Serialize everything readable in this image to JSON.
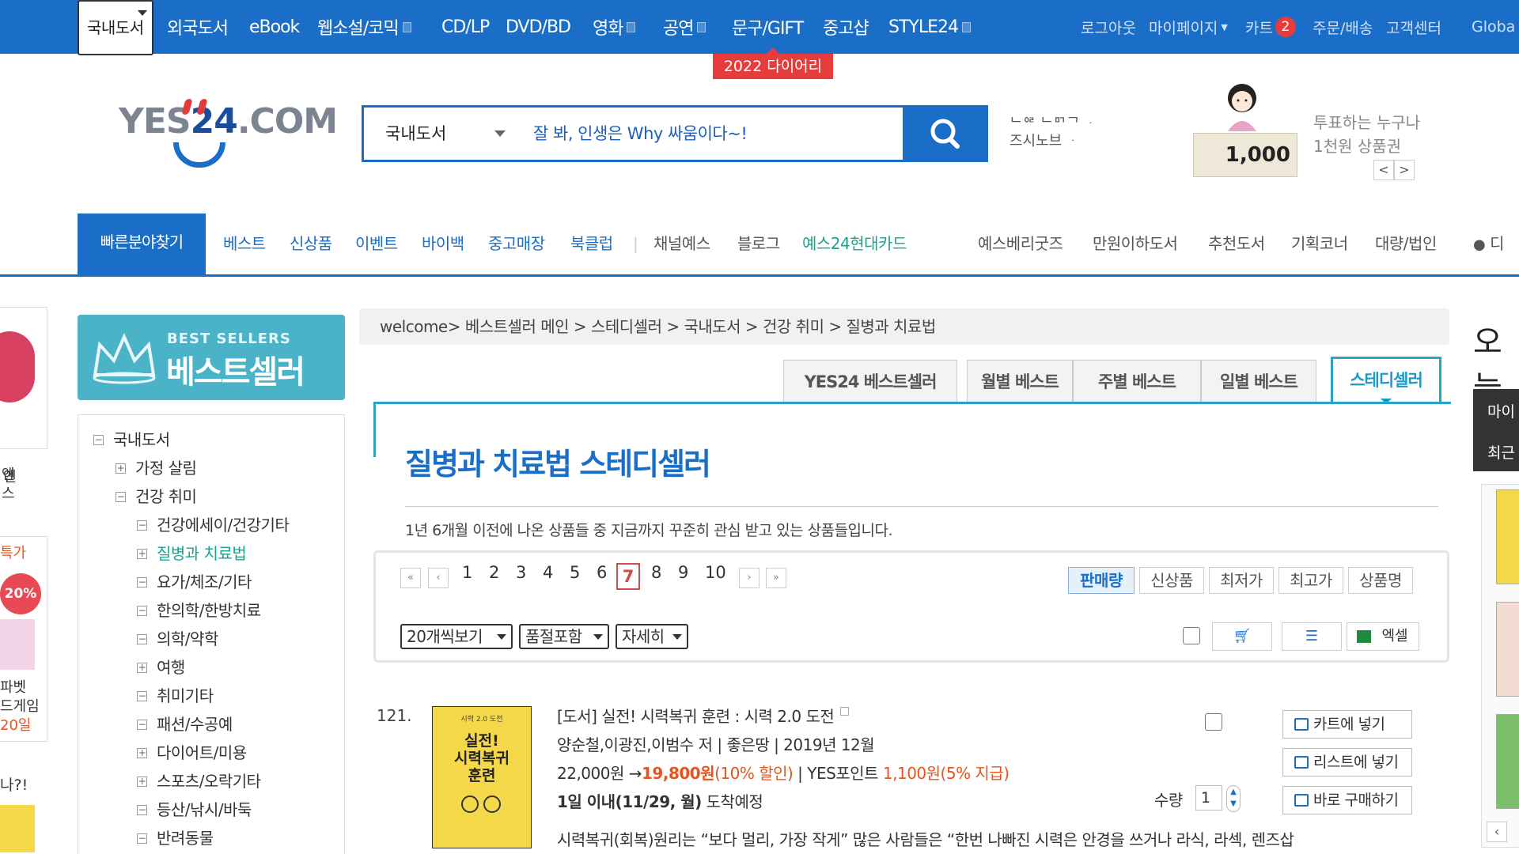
{
  "topnav": {
    "items": [
      {
        "label": "국내도서",
        "selected": true
      },
      {
        "label": "외국도서"
      },
      {
        "label": "eBook"
      },
      {
        "label": "웹소설/코믹",
        "box": true
      },
      {
        "label": "CD/LP"
      },
      {
        "label": "DVD/BD"
      },
      {
        "label": "영화",
        "box": true
      },
      {
        "label": "공연",
        "box": true
      },
      {
        "label": "문구/GIFT"
      },
      {
        "label": "중고샵"
      },
      {
        "label": "STYLE24",
        "box": true
      }
    ],
    "util": {
      "logout": "로그아웃",
      "mypage": "마이페이지",
      "cart": "카트",
      "cart_count": "2",
      "order": "주문/배송",
      "cs": "고객센터",
      "global": "Globa"
    },
    "promo": "2022 다이어리"
  },
  "header": {
    "logo_a": "YES",
    "logo_b": "24",
    "logo_c": ".COM",
    "search": {
      "category": "국내도서",
      "query": "잘 봐, 인생은 Why 싸움이다~!"
    },
    "recent_line1": "ᄂᄋᄅ ᄂᄆᄀᄀ ᆞ",
    "recent_line2": "즈시노브 ᆞ",
    "ad": {
      "amount": "1,000",
      "title1": "투표하는 누구나",
      "title2": "1천원 상품권",
      "prev": "<",
      "next": ">"
    }
  },
  "nav2": {
    "quick": "빠른분야찾기",
    "items": [
      "베스트",
      "신상품",
      "이벤트",
      "바이백",
      "중고매장",
      "북클럽",
      "채널예스",
      "블로그",
      "예스24현대카드",
      "예스베리굿즈",
      "만원이하도서",
      "추천도서",
      "기획코너",
      "대량/법인",
      "디"
    ]
  },
  "sidebar": {
    "banner_small": "BEST SELLERS",
    "banner_big": "베스트셀러",
    "tree": [
      {
        "label": "국내도서",
        "pm": "−"
      },
      {
        "label": "가정 살림",
        "pm": "+"
      },
      {
        "label": "건강 취미",
        "pm": "−"
      },
      {
        "label": "건강에세이/건강기타",
        "pm": "−"
      },
      {
        "label": "질병과 치료법",
        "pm": "+",
        "on": true
      },
      {
        "label": "요가/체조/기타",
        "pm": "−"
      },
      {
        "label": "한의학/한방치료",
        "pm": "−"
      },
      {
        "label": "의학/약학",
        "pm": "−"
      },
      {
        "label": "여행",
        "pm": "+"
      },
      {
        "label": "취미기타",
        "pm": "−"
      },
      {
        "label": "패션/수공예",
        "pm": "−"
      },
      {
        "label": "다이어트/미용",
        "pm": "+"
      },
      {
        "label": "스포츠/오락기타",
        "pm": "+"
      },
      {
        "label": "등산/낚시/바둑",
        "pm": "−"
      },
      {
        "label": "반려동물",
        "pm": "−"
      }
    ],
    "left_fragments": {
      "a": "엔",
      "b": "스",
      "c": "특가",
      "d": "20%",
      "e": "파벳",
      "f": "드게임",
      "g": "20일",
      "h": "나?!"
    }
  },
  "main": {
    "breadcrumb": "welcome> 베스트셀러 메인 > 스테디셀러 > 국내도서 > 건강 취미 > 질병과 치료법",
    "tabs": [
      "YES24 베스트셀러",
      "월별 베스트",
      "주별 베스트",
      "일별 베스트",
      "스테디셀러"
    ],
    "title": "질병과 치료법 스테디셀러",
    "description": "1년 6개월 이전에 나온 상품들 중 지금까지 꾸준히 관심 받고 있는 상품들입니다.",
    "pages": [
      "1",
      "2",
      "3",
      "4",
      "5",
      "6",
      "7",
      "8",
      "9",
      "10"
    ],
    "current_page": "7",
    "sort": [
      "판매량",
      "신상품",
      "최저가",
      "최고가",
      "상품명"
    ],
    "selects": [
      "20개씩보기",
      "품절포함",
      "자세히"
    ],
    "excel": "엑셀"
  },
  "product": {
    "rank": "121.",
    "cover_small": "시력 2.0 도전",
    "cover_title": "실전!\n시력복귀\n훈련",
    "title": "[도서] 실전! 시력복귀 훈련 : 시력 2.0 도전",
    "meta": "양순철,이광진,이범수 저 | 좋은땅 | 2019년 12월",
    "price": "22,000원",
    "arrow": "→",
    "sale_price": "19,800원",
    "discount": "(10% 할인)",
    "points_label": "| YES포인트",
    "points": "1,100원",
    "points_rate": "(5% 지급)",
    "delivery_b": "1일 이내(11/29, 월)",
    "delivery": "도착예정",
    "summary": "시력복귀(회복)원리는 “보다 멀리, 가장 작게” 많은 사람들은 “한번 나빠진 시력은 안경을 쓰거나 라식, 라섹, 렌즈삽",
    "qty_label": "수량",
    "qty": "1",
    "btn_cart": "카트에 넣기",
    "btn_list": "리스트에 넣기",
    "btn_buy": "바로 구매하기"
  },
  "right": {
    "today": "오늘",
    "my": "마이",
    "recent": "최근"
  }
}
